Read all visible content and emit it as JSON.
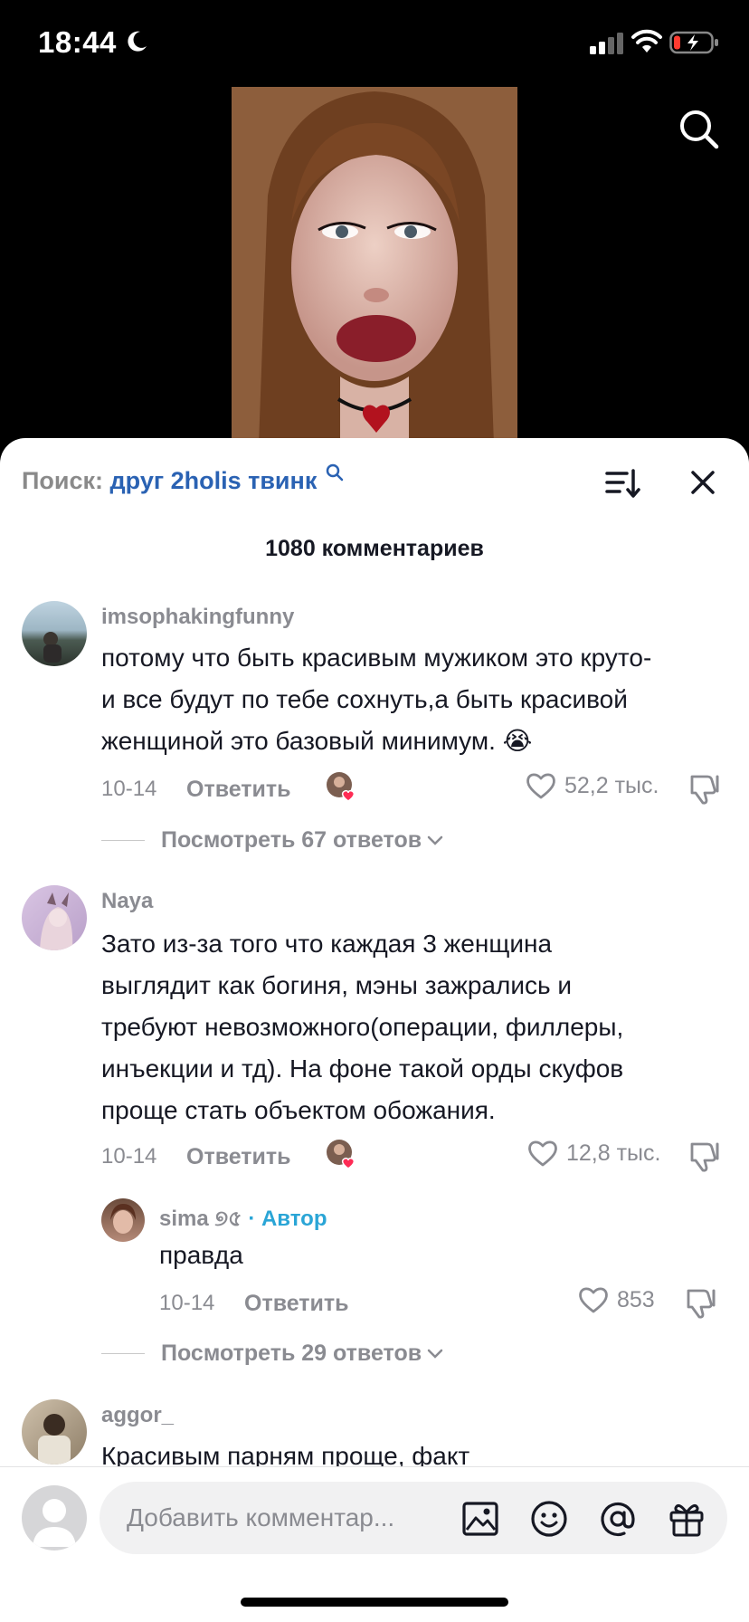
{
  "status_bar": {
    "time": "18:44"
  },
  "sheet": {
    "search_prefix": "Поиск:",
    "search_query": "друг 2holis твинк",
    "comment_count": "1080 комментариев"
  },
  "comments": [
    {
      "username": "imsophakingfunny",
      "lines": [
        "потому что быть красивым мужиком это круто-",
        "и все будут по тебе сохнуть,а быть красивой",
        "женщиной это базовый минимум. 😭"
      ],
      "date": "10-14",
      "reply_label": "Ответить",
      "likes": "52,2 тыс.",
      "view_replies": "Посмотреть 67 ответов"
    },
    {
      "username": "Naya",
      "lines": [
        "Зато из-за того что каждая 3 женщина",
        "выглядит как богиня, мэны зажрались и",
        "требуют невозможного(операции, филлеры,",
        "инъекции и тд). На фоне такой орды скуфов",
        "проще стать объектом обожания."
      ],
      "date": "10-14",
      "reply_label": "Ответить",
      "likes": "12,8 тыс.",
      "reply": {
        "username": "sima ୭৫",
        "author_label": "· Автор",
        "text": "правда",
        "date": "10-14",
        "reply_label": "Ответить",
        "likes": "853"
      },
      "view_replies": "Посмотреть 29 ответов"
    },
    {
      "username": "aggor_",
      "lines": [
        "Красивым парням проще, факт"
      ]
    }
  ],
  "composer": {
    "placeholder": "Добавить комментар..."
  },
  "colors": {
    "link_blue": "#2a62b3",
    "author_blue": "#2aa5d6",
    "like_red": "#fe2c55"
  }
}
